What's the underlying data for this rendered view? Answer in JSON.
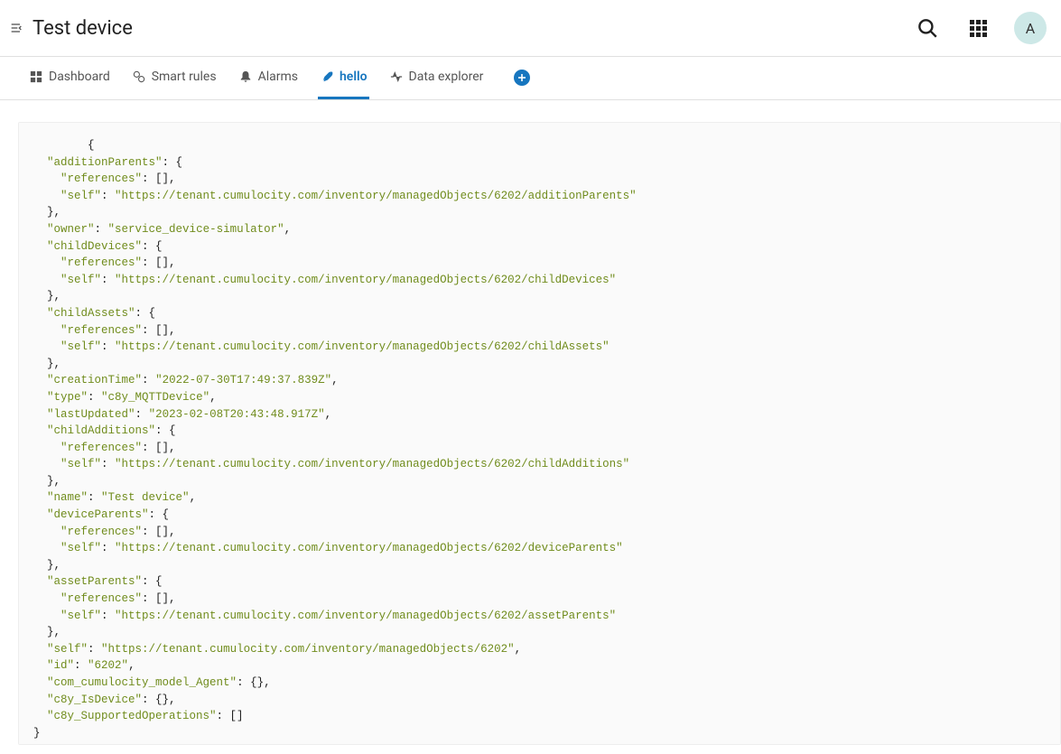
{
  "header": {
    "title": "Test device",
    "avatar_initial": "A"
  },
  "tabs": {
    "items": [
      {
        "label": "Dashboard"
      },
      {
        "label": "Smart rules"
      },
      {
        "label": "Alarms"
      },
      {
        "label": "hello"
      },
      {
        "label": "Data explorer"
      }
    ],
    "active_index": 3
  },
  "json_display": {
    "openBrace": "        {",
    "additionParents_key": "\"additionParents\"",
    "additionParents_open": ": {",
    "ap_refs_k": "    \"references\"",
    "ap_refs_v": ": [],",
    "ap_self_k": "    \"self\"",
    "ap_self_v": "\"https://tenant.cumulocity.com/inventory/managedObjects/6202/additionParents\"",
    "closeBlock": "  },",
    "owner_k": "\"owner\"",
    "owner_v": "\"service_device-simulator\"",
    "childDevices_k": "\"childDevices\"",
    "cd_self_v": "\"https://tenant.cumulocity.com/inventory/managedObjects/6202/childDevices\"",
    "childAssets_k": "\"childAssets\"",
    "ca_self_v": "\"https://tenant.cumulocity.com/inventory/managedObjects/6202/childAssets\"",
    "creationTime_k": "\"creationTime\"",
    "creationTime_v": "\"2022-07-30T17:49:37.839Z\"",
    "type_k": "\"type\"",
    "type_v": "\"c8y_MQTTDevice\"",
    "lastUpdated_k": "\"lastUpdated\"",
    "lastUpdated_v": "\"2023-02-08T20:43:48.917Z\"",
    "childAdditions_k": "\"childAdditions\"",
    "chadd_self_v": "\"https://tenant.cumulocity.com/inventory/managedObjects/6202/childAdditions\"",
    "name_k": "\"name\"",
    "name_v": "\"Test device\"",
    "deviceParents_k": "\"deviceParents\"",
    "dp_self_v": "\"https://tenant.cumulocity.com/inventory/managedObjects/6202/deviceParents\"",
    "assetParents_k": "\"assetParents\"",
    "asp_self_v": "\"https://tenant.cumulocity.com/inventory/managedObjects/6202/assetParents\"",
    "self_k": "\"self\"",
    "self_v": "\"https://tenant.cumulocity.com/inventory/managedObjects/6202\"",
    "id_k": "\"id\"",
    "id_v": "\"6202\"",
    "agent_k": "\"com_cumulocity_model_Agent\"",
    "agent_v": ": {},",
    "isDevice_k": "\"c8y_IsDevice\"",
    "isDevice_v": ": {},",
    "supportedOps_k": "\"c8y_SupportedOperations\"",
    "supportedOps_v": ": []",
    "closeAll": "}",
    "ref_k_indent": "    \"references\"",
    "self_k_indent": "    \"self\"",
    "colon_sp": ": ",
    "comma": ",",
    "open_block": ": {"
  }
}
